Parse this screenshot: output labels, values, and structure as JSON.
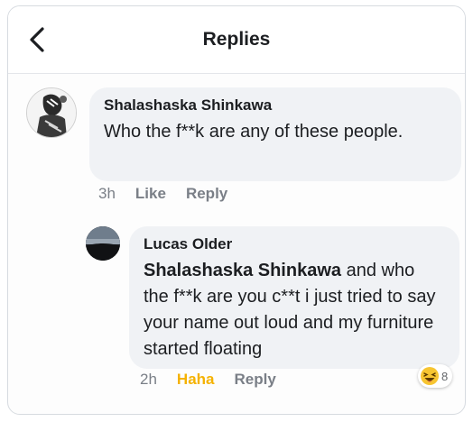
{
  "header": {
    "title": "Replies"
  },
  "comment": {
    "author": "Shalashaska Shinkawa",
    "text": "Who the f**k are any of these people.",
    "time": "3h",
    "like_label": "Like",
    "reply_label": "Reply"
  },
  "reply": {
    "author": "Lucas Older",
    "mention": "Shalashaska Shinkawa",
    "text": " and who the f**k are you c**t i just tried to say your name out loud and my furniture started floating",
    "time": "2h",
    "reaction_label": "Haha",
    "reply_label": "Reply",
    "reaction_count": "8"
  },
  "colors": {
    "haha": "#f5b200",
    "bubble": "#f0f2f5",
    "meta": "#7a7f87"
  },
  "icons": {
    "back": "chevron-left-icon",
    "reaction": "haha-emoji-icon"
  }
}
